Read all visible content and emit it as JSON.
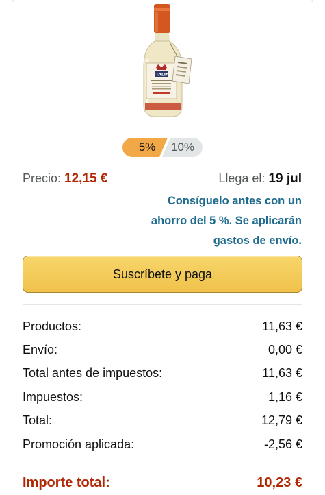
{
  "subscription": {
    "discount_options": [
      "5%",
      "10%"
    ],
    "selected_discount": "5%"
  },
  "price": {
    "label": "Precio:",
    "value": "12,15 €"
  },
  "delivery": {
    "label": "Llega el:",
    "date": "19 jul"
  },
  "promo_lines": [
    "Consíguelo antes con un",
    "ahorro del 5 %. Se aplicarán",
    "gastos de envío."
  ],
  "cta_label": "Suscríbete y paga",
  "summary": [
    {
      "label": "Productos:",
      "value": "11,63 €"
    },
    {
      "label": "Envío:",
      "value": "0,00 €"
    },
    {
      "label": "Total antes de impuestos:",
      "value": "11,63 €"
    },
    {
      "label": "Impuestos:",
      "value": "1,16 €"
    },
    {
      "label": "Total:",
      "value": "12,79 €"
    },
    {
      "label": "Promoción aplicada:",
      "value": "-2,56 €"
    }
  ],
  "grand_total": {
    "label": "Importe total:",
    "value": "10,23 €"
  },
  "colors": {
    "price_red": "#b12704",
    "promo_blue": "#1e6b8f",
    "toggle_selected": "#f3a847",
    "toggle_unselected": "#e3e6e6",
    "button_yellow": "#f0c14b"
  },
  "product_image": {
    "label_lettering": "ITALIA"
  }
}
